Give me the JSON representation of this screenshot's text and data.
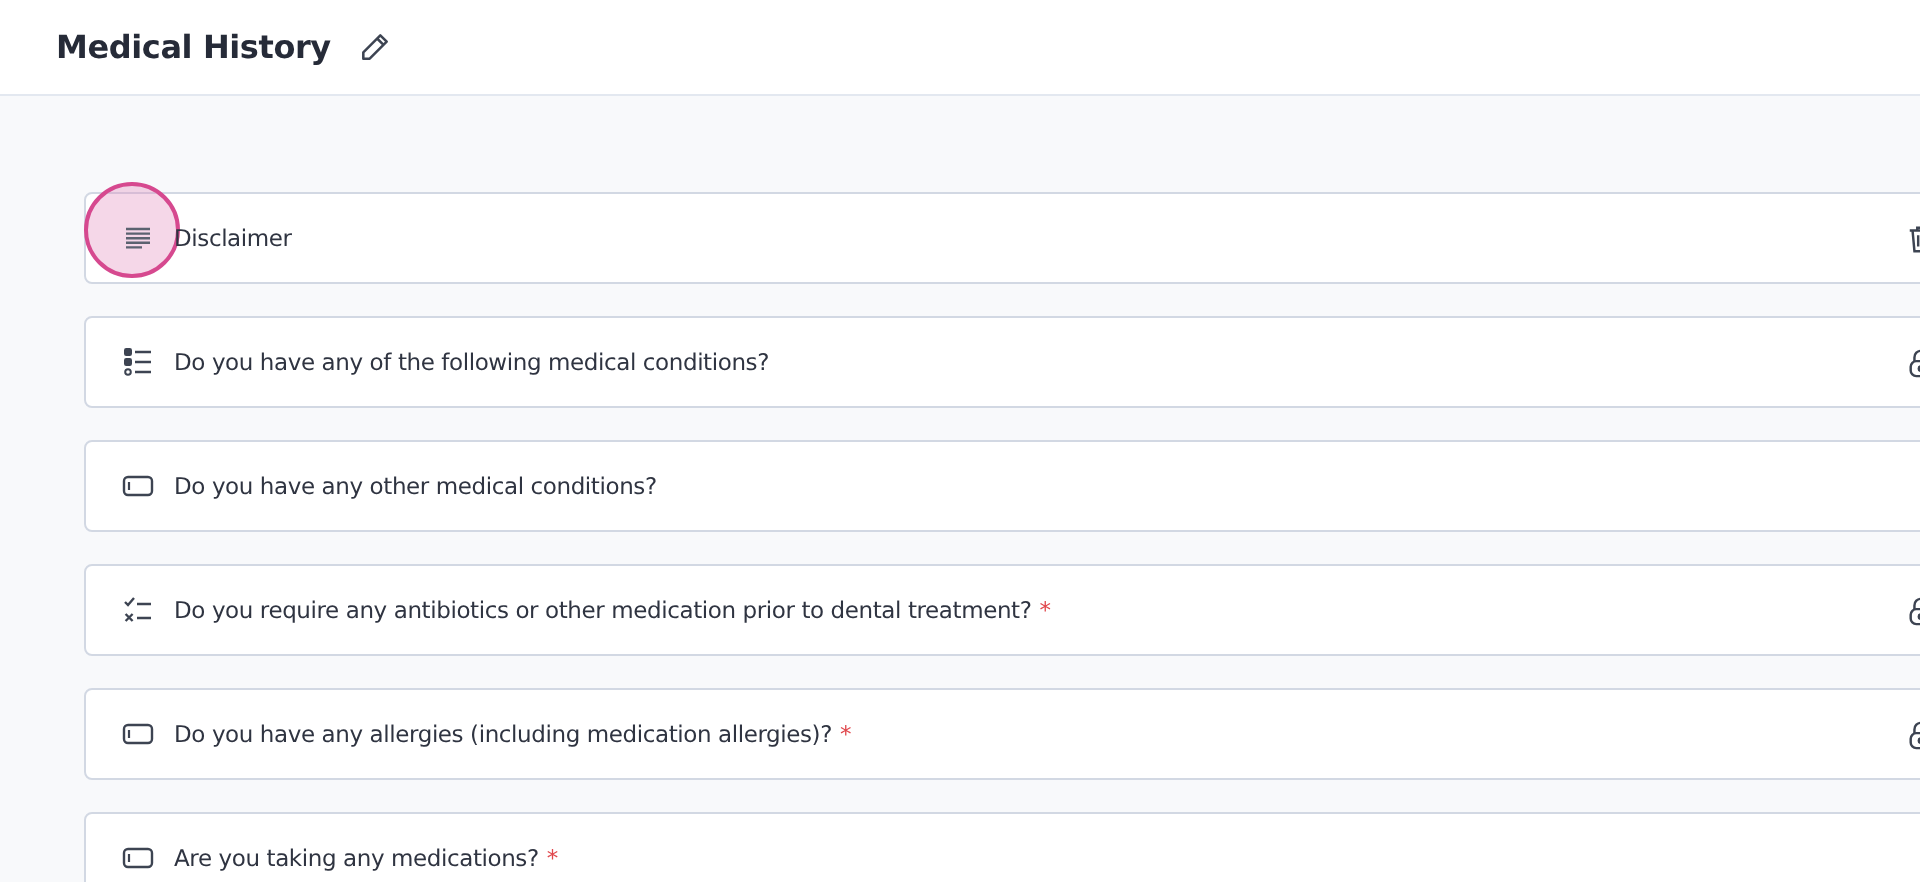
{
  "header": {
    "title": "Medical History"
  },
  "questions": [
    {
      "kind": "text",
      "label": "Disclaimer",
      "highlighted": true,
      "deletable": true,
      "locked": false
    },
    {
      "kind": "multi",
      "label": "Do you have any of the following medical conditions?",
      "highlighted": false,
      "deletable": false,
      "locked": true
    },
    {
      "kind": "input",
      "label": "Do you have any other medical conditions?",
      "highlighted": false,
      "deletable": false,
      "locked": false
    },
    {
      "kind": "checklist",
      "label": "Do you require any antibiotics or other medication prior to dental treatment?",
      "required_mark": "*",
      "highlighted": false,
      "deletable": false,
      "locked": true
    },
    {
      "kind": "input",
      "label": "Do you have any allergies (including medication allergies)?",
      "required_mark": "*",
      "highlighted": false,
      "deletable": false,
      "locked": true
    },
    {
      "kind": "input",
      "label": "Are you taking any medications?",
      "required_mark": "*",
      "highlighted": false,
      "deletable": false,
      "locked": false
    }
  ]
}
